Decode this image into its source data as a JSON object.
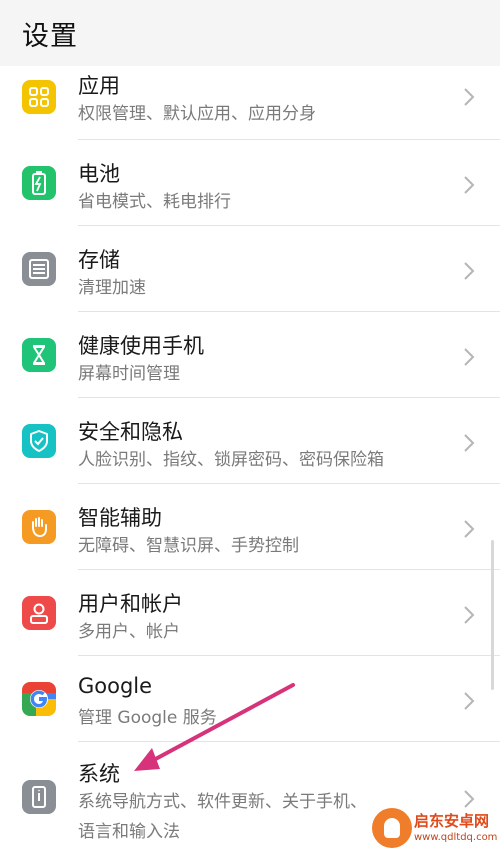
{
  "header": {
    "title": "设置"
  },
  "items": [
    {
      "title": "应用",
      "subtitle": "权限管理、默认应用、应用分身",
      "icon": "apps-grid-icon",
      "color": "#f5c400"
    },
    {
      "title": "电池",
      "subtitle": "省电模式、耗电排行",
      "icon": "battery-icon",
      "color": "#22c36b"
    },
    {
      "title": "存储",
      "subtitle": "清理加速",
      "icon": "storage-icon",
      "color": "#8a8f96"
    },
    {
      "title": "健康使用手机",
      "subtitle": "屏幕时间管理",
      "icon": "hourglass-icon",
      "color": "#1fc478"
    },
    {
      "title": "安全和隐私",
      "subtitle": "人脸识别、指纹、锁屏密码、密码保险箱",
      "icon": "shield-check-icon",
      "color": "#16c2c4"
    },
    {
      "title": "智能辅助",
      "subtitle": "无障碍、智慧识屏、手势控制",
      "icon": "hand-icon",
      "color": "#f59a23"
    },
    {
      "title": "用户和帐户",
      "subtitle": "多用户、帐户",
      "icon": "user-icon",
      "color": "#ef4a4a"
    },
    {
      "title": "Google",
      "subtitle": "管理 Google 服务",
      "icon": "google-icon",
      "color": "#4285f4"
    },
    {
      "title": "系统",
      "subtitle": "系统导航方式、软件更新、关于手机、",
      "subtitle2": "语言和输入法",
      "icon": "system-phone-icon",
      "color": "#8a8f96"
    }
  ],
  "annotation": {
    "arrow_color": "#d6337a"
  },
  "watermark": {
    "name": "启东安卓网",
    "url": "www.qdltdq.com"
  }
}
